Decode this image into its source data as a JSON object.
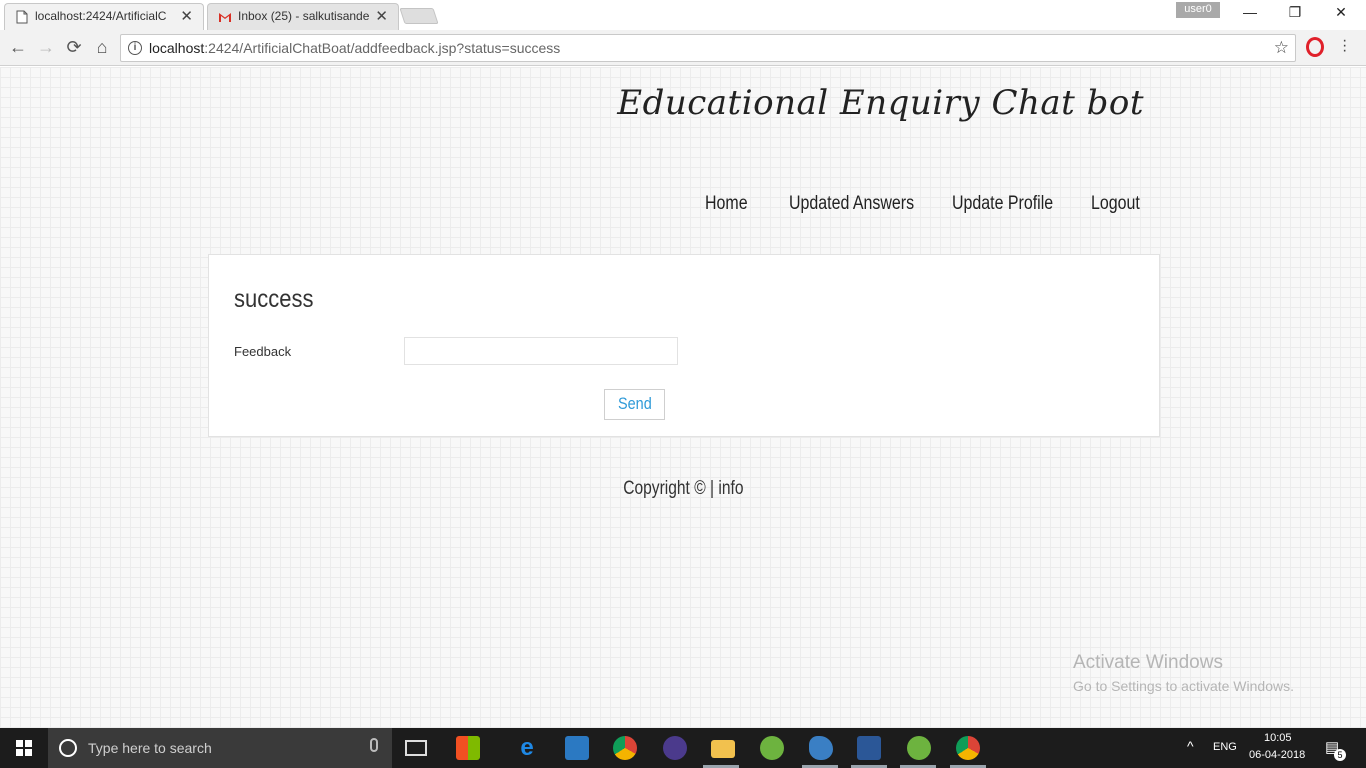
{
  "browser": {
    "tabs": [
      {
        "title": "localhost:2424/ArtificialC",
        "active": true
      },
      {
        "title": "Inbox (25) - salkutisande",
        "active": false
      }
    ],
    "user_badge": "user0",
    "url_host": "localhost",
    "url_rest": ":2424/ArtificialChatBoat/addfeedback.jsp?status=success"
  },
  "site": {
    "title": "Educational Enquiry Chat bot",
    "nav": [
      "Home",
      "Updated Answers",
      "Update Profile",
      "Logout"
    ]
  },
  "form": {
    "heading": "success",
    "feedback_label": "Feedback",
    "feedback_value": "",
    "send_label": "Send"
  },
  "footer": {
    "copyright": "Copyright ©",
    "separator": "|",
    "link": "info"
  },
  "watermark": {
    "line1": "Activate Windows",
    "line2": "Go to Settings to activate Windows."
  },
  "taskbar": {
    "search_placeholder": "Type here to search",
    "language": "ENG",
    "time": "10:05",
    "date": "06-04-2018",
    "notification_count": "5"
  }
}
